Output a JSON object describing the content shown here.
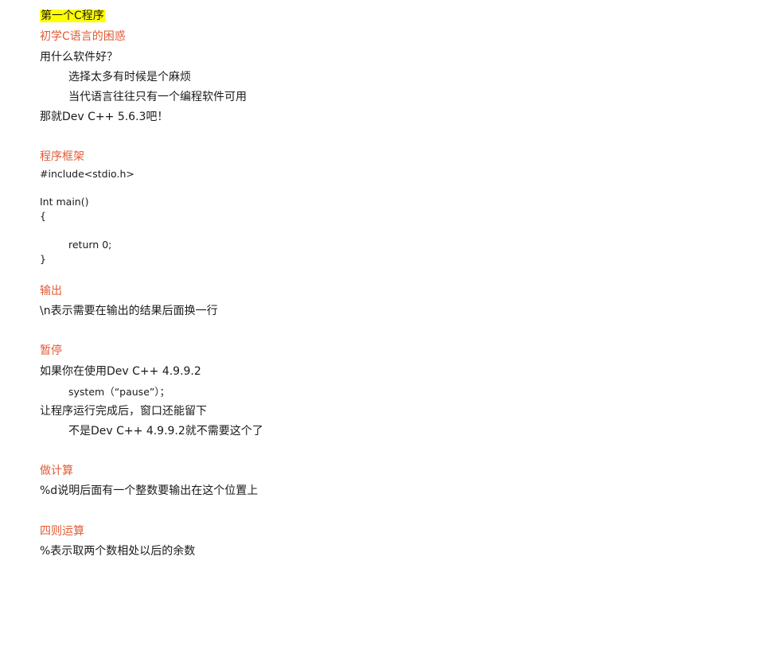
{
  "accent_color": "#e25a36",
  "highlight_color": "#ffff00",
  "document": {
    "title": "第一个C程序",
    "sections": {
      "confusion": {
        "heading": "初学C语言的困惑",
        "lines": [
          "用什么软件好？",
          "选择太多有时候是个麻烦",
          "当代语言往往只有一个编程软件可用",
          "那就Dev C++ 5.6.3吧！"
        ]
      },
      "framework": {
        "heading": "程序框架",
        "code": [
          "#include<stdio.h>",
          "Int main()",
          "{",
          "return 0;",
          "}"
        ]
      },
      "output": {
        "heading": "输出",
        "lines": [
          "\\n表示需要在输出的结果后面换一行"
        ]
      },
      "pause": {
        "heading": "暂停",
        "lines": [
          "如果你在使用Dev C++ 4.9.9.2",
          "system（“pause”）；",
          "让程序运行完成后，窗口还能留下",
          "不是Dev C++ 4.9.9.2就不需要这个了"
        ]
      },
      "calc": {
        "heading": "做计算",
        "lines": [
          "%d说明后面有一个整数要输出在这个位置上"
        ]
      },
      "arith": {
        "heading": "四则运算",
        "lines": [
          "%表示取两个数相处以后的余数"
        ]
      }
    }
  }
}
